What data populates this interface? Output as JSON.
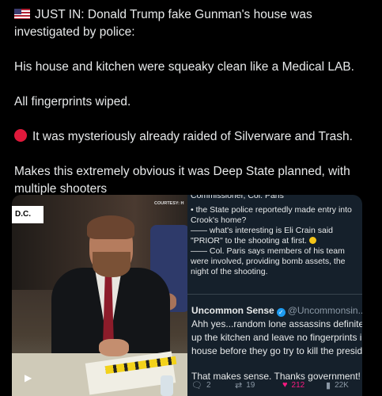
{
  "post": {
    "line1": "JUST IN: Donald Trump fake Gunman's house was investigated by police:",
    "line2": "His house and kitchen were squeaky clean like a Medical LAB.",
    "line3": "All fingerprints wiped.",
    "line4": "It was mysteriously already raided of Silverware and Trash.",
    "line5": "Makes this extremely obvious it was Deep State planned, with multiple shooters"
  },
  "video": {
    "location_label": "D.C.",
    "courtesy_label": "COURTESY: H",
    "play_icon": "play-icon"
  },
  "quoted": {
    "header": "Commissioner, Col. Paris",
    "bullet1": "• the State police reportedly made entry into Crook's home?",
    "bullet2": "—— what's interesting is Eli Crain said \"PRIOR\" to the shooting at first.",
    "bullet3": "—— Col. Paris says members of his team were involved, providing bomb assets, the night of the shooting."
  },
  "reply": {
    "name": "Uncommon Sense",
    "handle": "@Uncommonsin... · 1",
    "line1": "Ahh yes...random lone assassins definitely",
    "line2": "up the kitchen and leave no fingerprints in",
    "line3": "house before they go try to kill the presider",
    "line4": "That makes sense. Thanks government!",
    "replies": "2",
    "reposts": "19",
    "likes": "212",
    "views": "22K"
  },
  "colors": {
    "like": "#f91880",
    "verified": "#1d9bf0",
    "quote_bg": "#15202b"
  }
}
